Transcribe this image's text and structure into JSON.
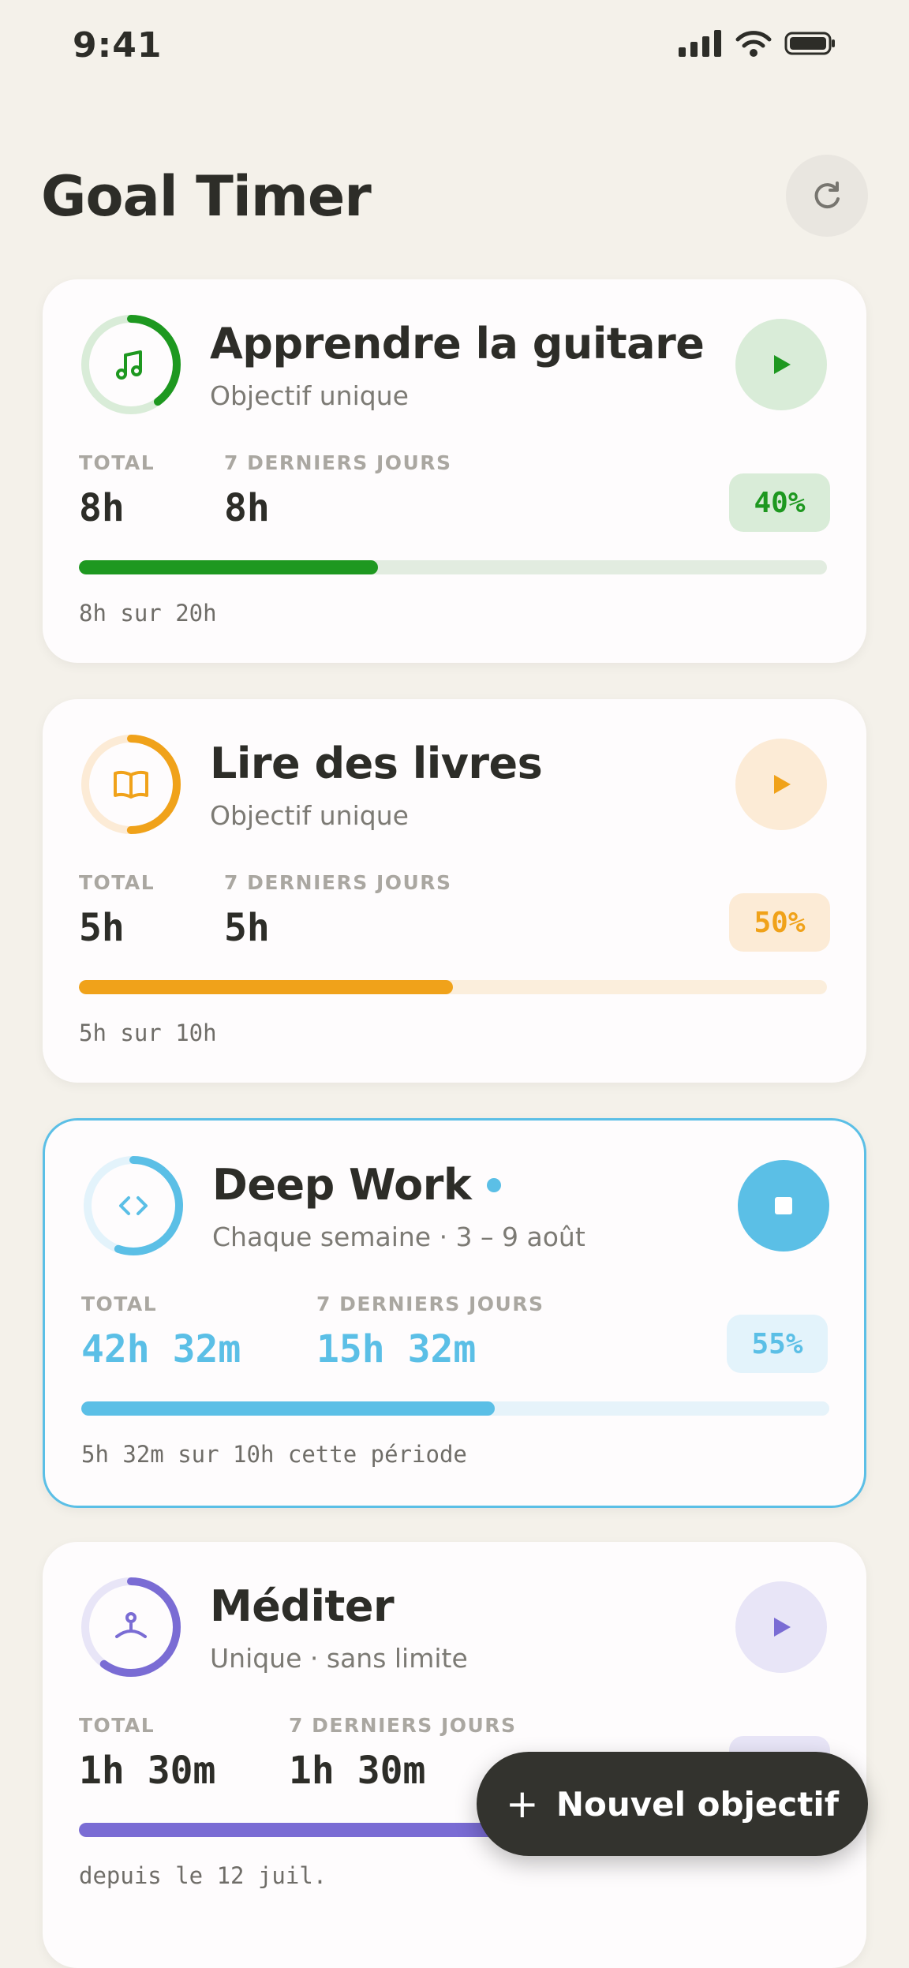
{
  "status_bar": {
    "time": "9:41"
  },
  "header": {
    "title": "Goal Timer",
    "refresh_icon": "refresh-icon"
  },
  "labels": {
    "total": "TOTAL",
    "last7": "7 DERNIERS JOURS"
  },
  "goals": [
    {
      "title": "Apprendre la guitare",
      "subtitle": "Objectif unique",
      "icon": "music-note-icon",
      "color": "#1e9820",
      "tint": "#d9ecd8",
      "track": "#e2ece0",
      "total": "8h",
      "last7": "8h",
      "percent_label": "40%",
      "progress": 0.4,
      "note": "8h sur 20h",
      "running": false,
      "action_icon": "play-icon"
    },
    {
      "title": "Lire des livres",
      "subtitle": "Objectif unique",
      "icon": "book-icon",
      "color": "#f0a21a",
      "tint": "#fcebd6",
      "track": "#fbeedc",
      "total": "5h",
      "last7": "5h",
      "percent_label": "50%",
      "progress": 0.5,
      "note": "5h sur 10h",
      "running": false,
      "action_icon": "play-icon"
    },
    {
      "title": "Deep Work",
      "subtitle": "Chaque semaine · 3 – 9 août",
      "icon": "code-icon",
      "color": "#5bbfe6",
      "tint": "#e3f3fb",
      "track": "#e6f3fa",
      "total": "42h 32m",
      "last7": "15h 32m",
      "percent_label": "55%",
      "progress": 0.553,
      "note": "5h 32m sur 10h cette période",
      "running": true,
      "action_icon": "stop-icon"
    },
    {
      "title": "Méditer",
      "subtitle": "Unique · sans limite",
      "icon": "meditation-icon",
      "color": "#7a6cd4",
      "tint": "#e8e5f7",
      "track": "#ebe8f6",
      "total": "1h 30m",
      "last7": "1h 30m",
      "progress": 0.6,
      "note": "depuis le 12 juil.",
      "running": false,
      "action_icon": "play-icon"
    }
  ],
  "fab": {
    "label": "Nouvel objectif",
    "icon": "plus-icon"
  }
}
